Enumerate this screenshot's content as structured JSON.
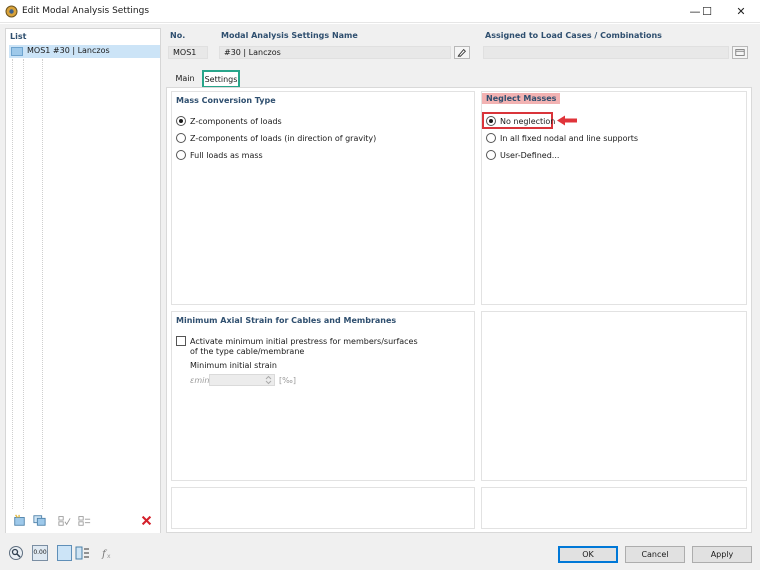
{
  "window": {
    "title": "Edit Modal Analysis Settings",
    "controls": {
      "minimize": "—",
      "maximize": "☐",
      "close": "✕"
    }
  },
  "list": {
    "header": "List",
    "items": [
      {
        "label": "MOS1  #30 | Lanczos",
        "selected": true
      }
    ]
  },
  "header_fields": {
    "no_label": "No.",
    "no_value": "MOS1",
    "name_label": "Modal Analysis Settings Name",
    "name_value": "#30 | Lanczos",
    "assigned_label": "Assigned to Load Cases / Combinations",
    "assigned_value": ""
  },
  "tabs": [
    {
      "label": "Main",
      "active": false
    },
    {
      "label": "Settings",
      "active": true
    }
  ],
  "mass_conversion": {
    "title": "Mass Conversion Type",
    "options": [
      {
        "label": "Z-components of loads",
        "selected": true
      },
      {
        "label": "Z-components of loads (in direction of gravity)",
        "selected": false
      },
      {
        "label": "Full loads as mass",
        "selected": false
      }
    ]
  },
  "neglect_masses": {
    "title": "Neglect Masses",
    "options": [
      {
        "label": "No neglection",
        "selected": true
      },
      {
        "label": "In all fixed nodal and line supports",
        "selected": false
      },
      {
        "label": "User-Defined...",
        "selected": false
      }
    ]
  },
  "axial_strain": {
    "title": "Minimum Axial Strain for Cables and Membranes",
    "checkbox_line1": "Activate minimum initial prestress for members/surfaces",
    "checkbox_line2": "of the type cable/membrane",
    "checked": false,
    "sub_label": "Minimum initial strain",
    "symbol": "εmin",
    "value": "",
    "unit": "[‰]"
  },
  "buttons": {
    "ok": "OK",
    "cancel": "Cancel",
    "apply": "Apply"
  },
  "bottom_value_icon": "0.00",
  "colors": {
    "accent_tab": "#28a58a",
    "highlight_red": "#d9343a",
    "selection_blue": "#cce4f7"
  }
}
